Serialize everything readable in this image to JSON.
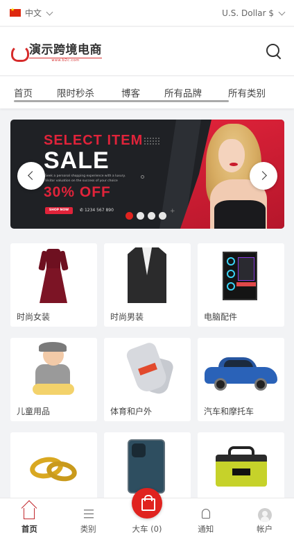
{
  "topbar": {
    "language": "中文",
    "currency": "U.S. Dollar $"
  },
  "header": {
    "logo_text": "演示跨境电商",
    "logo_subtext": "www.b2c.com"
  },
  "nav": {
    "items": [
      {
        "label": "首页"
      },
      {
        "label": "限时秒杀"
      },
      {
        "label": "博客"
      },
      {
        "label": "所有品牌"
      },
      {
        "label": "所有类别"
      }
    ]
  },
  "banner": {
    "line1_white": "SELECT",
    "line1_red": "ITEM",
    "headline": "SALE",
    "description": "Seek a personal shopping experience with a luxury. Visitor valuation on the success of your choice",
    "discount_red": "30%",
    "discount_white": "OFF",
    "cta": "SHOP NOW",
    "phone": "1234 567 890",
    "slide_count": 4,
    "active_slide": 1
  },
  "categories": [
    {
      "label": "时尚女装",
      "icon": "dress"
    },
    {
      "label": "时尚男装",
      "icon": "jacket"
    },
    {
      "label": "电脑配件",
      "icon": "pc-case"
    },
    {
      "label": "儿童用品",
      "icon": "baby"
    },
    {
      "label": "体育和户外",
      "icon": "gloves"
    },
    {
      "label": "汽车和摩托车",
      "icon": "car"
    },
    {
      "label": "",
      "icon": "rings"
    },
    {
      "label": "",
      "icon": "phone"
    },
    {
      "label": "",
      "icon": "tool-bag"
    }
  ],
  "bottom_nav": {
    "home": "首页",
    "categories": "类别",
    "cart": "大车 (0)",
    "notifications": "通知",
    "account": "帐户"
  },
  "colors": {
    "accent": "#e0231f",
    "brand": "#c1272d"
  }
}
